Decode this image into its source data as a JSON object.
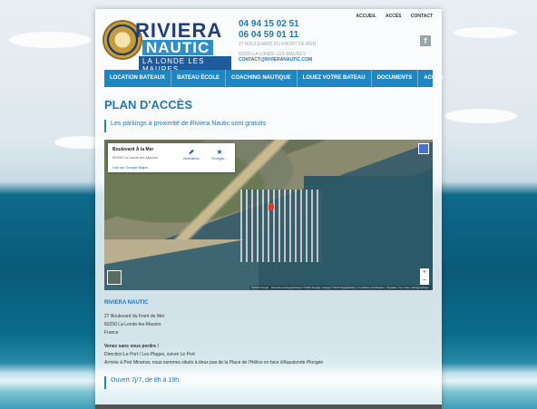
{
  "header": {
    "logo": {
      "word1": "RIVIERA",
      "word2": "NAUTIC",
      "tagline": "LA LONDE LES MAURES"
    },
    "phone1": "04 94 15 02 51",
    "phone2": "06 04 59 01 11",
    "address_line1": "27 BOULEVARD DU FRONT DE MER",
    "address_line2": "83250 LA LONDE-LES-MAURES",
    "email": "CONTACT@RIVIERANAUTIC.COM",
    "top_links": [
      "ACCUEIL",
      "ACCÈS",
      "CONTACT"
    ],
    "social": "f"
  },
  "menu": [
    "LOCATION BATEAUX",
    "BATEAU ÉCOLE",
    "COACHING NAUTIQUE",
    "LOUEZ VOTRE BATEAU",
    "DOCUMENTS",
    "ACCÈS"
  ],
  "page": {
    "title": "PLAN D'ACCÈS",
    "parking_note": "Les parkings à proximité de Riviera Nautic sont gratuits"
  },
  "map": {
    "place_name": "Boulevard À la Mer",
    "place_address": "83250 La Londe-les-Maures",
    "link": "Voir sur Google Maps",
    "action1": "Itinéraires",
    "action2": "Enregis...",
    "zoom_in": "+",
    "zoom_out": "−",
    "credits": "©2015 Google · Données cartographiques ©2015 Google, Images ©2015 DigitalGlobe  |  Conditions d'utilisation  |  Signaler une erreur cartographique"
  },
  "contact": {
    "name": "RIVIERA NAUTIC",
    "line1": "27 Boulevard du Front de Mer",
    "line2": "83250 La Londe-les-Maures",
    "line3": "France",
    "directions_title": "Venez sans vous perdre !",
    "dir1": "Direction Le Port / Les Plages, suivre Le Port",
    "dir2": "Arrivée à Port Miramar, nous sommes situés à deux pas de la Place de l'Hélice en face d'Aqualonde Plongée"
  },
  "hours": "Ouvert 7j/7, de 8h à 19h"
}
